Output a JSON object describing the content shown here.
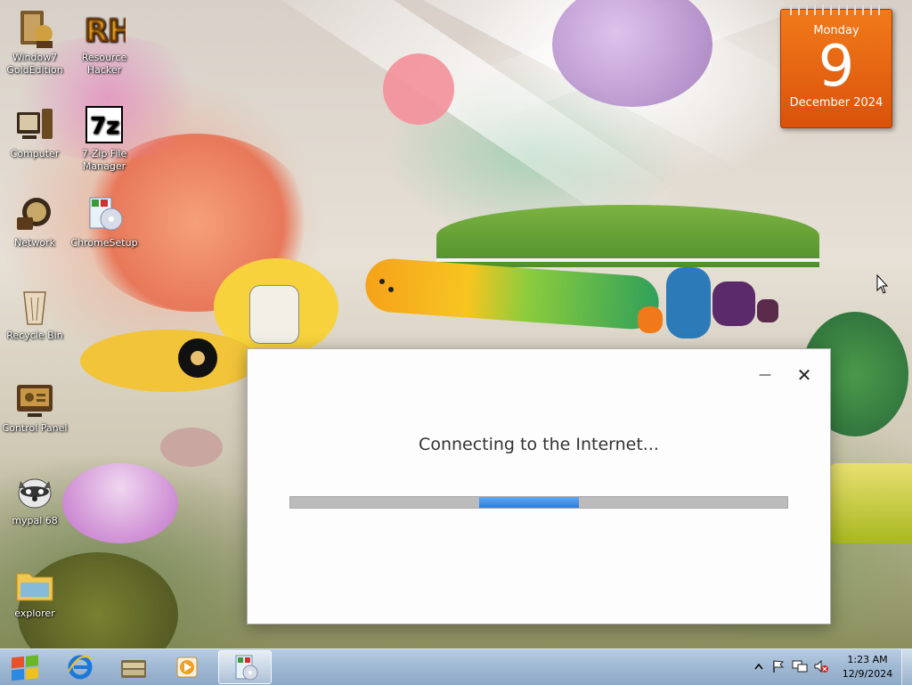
{
  "desktop": {
    "icons": [
      {
        "label": "Window7\nGoldEdition",
        "icon": "windows7-gold-icon"
      },
      {
        "label": "Resource\nHacker",
        "icon": "resource-hacker-icon"
      },
      {
        "label": "Computer",
        "icon": "computer-icon"
      },
      {
        "label": "7-Zip File\nManager",
        "icon": "7zip-icon"
      },
      {
        "label": "Network",
        "icon": "network-icon"
      },
      {
        "label": "ChromeSetup",
        "icon": "chrome-setup-icon"
      },
      {
        "label": "Recycle Bin",
        "icon": "recycle-bin-icon"
      },
      {
        "label": "Control Panel",
        "icon": "control-panel-icon"
      },
      {
        "label": "mypal 68",
        "icon": "mypal-icon"
      },
      {
        "label": "explorer",
        "icon": "explorer-folder-icon"
      }
    ]
  },
  "calendar": {
    "weekday": "Monday",
    "day": "9",
    "month_year": "December 2024"
  },
  "dialog": {
    "message": "Connecting to the Internet...",
    "minimize_glyph": "—",
    "close_glyph": "✕",
    "progress_style": "indeterminate",
    "progress_color": "#2b7ddc"
  },
  "taskbar": {
    "pinned": [
      {
        "icon": "internet-explorer-icon"
      },
      {
        "icon": "library-folder-icon"
      },
      {
        "icon": "media-player-icon"
      },
      {
        "icon": "chrome-setup-task-icon"
      }
    ],
    "clock": {
      "time": "1:23 AM",
      "date": "12/9/2024"
    },
    "tray": [
      "show-hidden-icons",
      "action-center-flag-icon",
      "network-tray-icon",
      "volume-muted-icon"
    ]
  }
}
